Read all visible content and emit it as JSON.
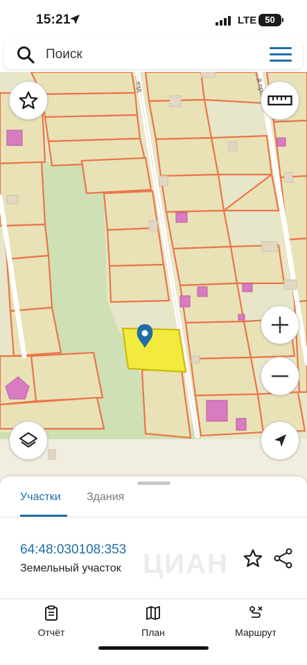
{
  "status_bar": {
    "time": "15:21",
    "network": "LTE",
    "battery": "50"
  },
  "search": {
    "placeholder": "Поиск"
  },
  "map": {
    "road_labels": [
      "...езд",
      "...й проезд"
    ],
    "selected_parcel_color": "#f2ea3c",
    "building_color": "#d97bc0",
    "boundary_color": "#e9754a"
  },
  "map_controls": {
    "favorite": "star-icon",
    "ruler": "ruler-icon",
    "zoom_in": "+",
    "zoom_out": "−",
    "layers": "layers-icon",
    "locate": "navigation-arrow-icon"
  },
  "panel": {
    "tabs": [
      {
        "label": "Участки",
        "active": true
      },
      {
        "label": "Здания",
        "active": false
      }
    ],
    "parcel": {
      "number": "64:48:030108:353",
      "type": "Земельный участок"
    },
    "watermark": "ЦИАН"
  },
  "bottom_nav": [
    {
      "label": "Отчёт",
      "icon": "report-icon"
    },
    {
      "label": "План",
      "icon": "map-icon"
    },
    {
      "label": "Маршрут",
      "icon": "route-icon"
    }
  ],
  "colors": {
    "accent": "#1f6ea8"
  }
}
